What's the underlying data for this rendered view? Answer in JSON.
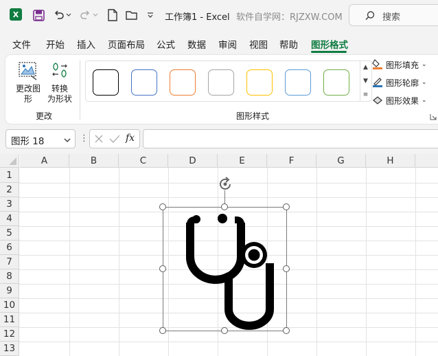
{
  "titlebar": {
    "title": "工作簿1 - Excel",
    "site": "软件自学网：RJZXW.COM",
    "search_label": "搜索"
  },
  "menu": {
    "tabs": [
      "文件",
      "开始",
      "插入",
      "页面布局",
      "公式",
      "数据",
      "审阅",
      "视图",
      "帮助",
      "图形格式"
    ],
    "active": "图形格式"
  },
  "ribbon": {
    "change_shape": "更改图\n形",
    "convert_shape": "转换\n为形状",
    "group_change": "更改",
    "group_styles": "图形样式",
    "fill": "图形填充",
    "outline": "图形轮廓",
    "effects": "图形效果",
    "swatches": [
      "#000000",
      "#4472c4",
      "#ed7d31",
      "#a5a5a5",
      "#ffc000",
      "#5b9bd5",
      "#70ad47"
    ]
  },
  "formula_bar": {
    "name_box": "图形 18",
    "fx": "fx",
    "value": ""
  },
  "sheet": {
    "columns": [
      "A",
      "B",
      "C",
      "D",
      "E",
      "F",
      "G",
      "H"
    ],
    "rows": [
      "1",
      "2",
      "3",
      "4",
      "5",
      "6",
      "7",
      "8",
      "9",
      "10",
      "11",
      "12",
      "13"
    ]
  },
  "shape": {
    "icon": "stethoscope-icon"
  }
}
